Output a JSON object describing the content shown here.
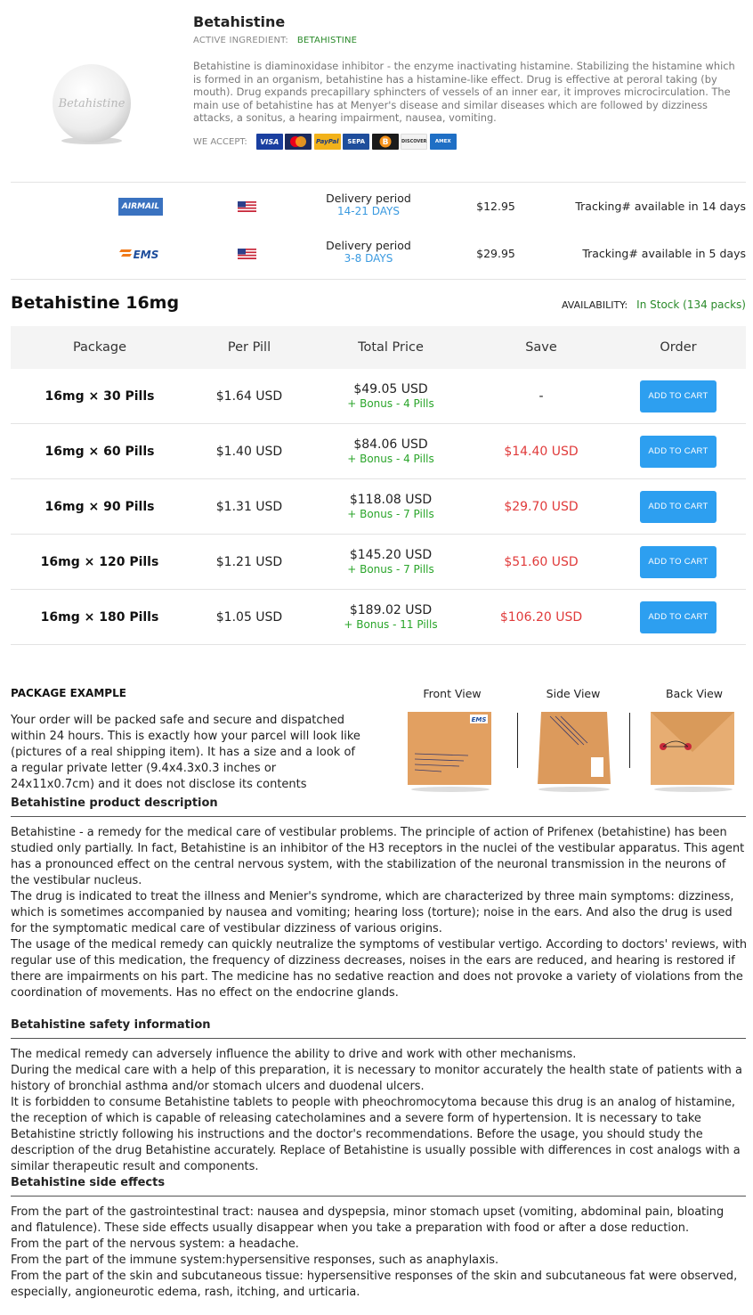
{
  "product": {
    "name": "Betahistine",
    "image_text": "Betahistine",
    "active_ingredient_label": "ACTIVE INGREDIENT:",
    "active_ingredient": "BETAHISTINE",
    "description": "Betahistine is diaminoxidase inhibitor - the enzyme inactivating histamine. Stabilizing the histamine which is formed in an organism, betahistine has a histamine-like effect. Drug is effective at peroral taking (by mouth). Drug expands precapillary sphincters of vessels of an inner ear, it improves microcirculation. The main use of betahistine has at Menyer's disease and similar diseases which are followed by dizziness attacks, a sonitus, a hearing impairment, nausea, vomiting.",
    "we_accept_label": "WE ACCEPT:",
    "payment_methods": [
      {
        "name": "VISA",
        "color": "#1a3fa0"
      },
      {
        "name": "MC",
        "color": "#1b2a5e"
      },
      {
        "name": "PayPal",
        "color": "#f2b21a"
      },
      {
        "name": "SEPA",
        "color": "#1f4e9c"
      },
      {
        "name": "B",
        "color": "#f7931a"
      },
      {
        "name": "DISCOVER",
        "color": "#f2f2f2"
      },
      {
        "name": "AMEX",
        "color": "#1f6fc5"
      }
    ]
  },
  "shipping": [
    {
      "carrier": "AIRMAIL",
      "flag": "us-flag",
      "period_label": "Delivery period",
      "days": "14-21 DAYS",
      "price": "$12.95",
      "tracking": "Tracking# available in 14 days"
    },
    {
      "carrier": "EMS",
      "flag": "us-flag",
      "period_label": "Delivery period",
      "days": "3-8 DAYS",
      "price": "$29.95",
      "tracking": "Tracking# available in 5 days"
    }
  ],
  "strength": {
    "title": "Betahistine 16mg",
    "availability_label": "AVAILABILITY:",
    "availability": "In Stock (134 packs)"
  },
  "table": {
    "headers": [
      "Package",
      "Per Pill",
      "Total Price",
      "Save",
      "Order"
    ],
    "rows": [
      {
        "package": "16mg × 30 Pills",
        "per_pill": "$1.64 USD",
        "total": "$49.05 USD",
        "bonus": "+ Bonus - 4 Pills",
        "save": "-",
        "button": "ADD TO CART"
      },
      {
        "package": "16mg × 60 Pills",
        "per_pill": "$1.40 USD",
        "total": "$84.06 USD",
        "bonus": "+ Bonus - 4 Pills",
        "save": "$14.40 USD",
        "button": "ADD TO CART"
      },
      {
        "package": "16mg × 90 Pills",
        "per_pill": "$1.31 USD",
        "total": "$118.08 USD",
        "bonus": "+ Bonus - 7 Pills",
        "save": "$29.70 USD",
        "button": "ADD TO CART"
      },
      {
        "package": "16mg × 120 Pills",
        "per_pill": "$1.21 USD",
        "total": "$145.20 USD",
        "bonus": "+ Bonus - 7 Pills",
        "save": "$51.60 USD",
        "button": "ADD TO CART"
      },
      {
        "package": "16mg × 180 Pills",
        "per_pill": "$1.05 USD",
        "total": "$189.02 USD",
        "bonus": "+ Bonus - 11 Pills",
        "save": "$106.20 USD",
        "button": "ADD TO CART"
      }
    ]
  },
  "package_example": {
    "title": "PACKAGE EXAMPLE",
    "text": "Your order will be packed safe and secure and dispatched within 24 hours. This is exactly how your parcel will look like (pictures of a real shipping item). It has a size and a look of a regular private letter (9.4x4.3x0.3 inches or 24x11x0.7cm) and it does not disclose its contents",
    "views": [
      "Front View",
      "Side View",
      "Back View"
    ]
  },
  "sections": [
    {
      "title": "Betahistine product description",
      "paragraphs": [
        "Betahistine - a remedy for the medical care of vestibular problems. The principle of action of Prifenex (betahistine) has been studied only partially. In fact, Betahistine is an inhibitor of the H3 receptors in the nuclei of the vestibular apparatus. This agent has a pronounced effect on the central nervous system, with the stabilization of the neuronal transmission in the neurons of the vestibular nucleus.",
        "The drug is indicated to treat the illness and Menier's syndrome, which are characterized by three main symptoms: dizziness, which is sometimes accompanied by nausea and vomiting; hearing loss (torture); noise in the ears. And also the drug is used for the symptomatic medical care of vestibular dizziness of various origins.",
        "The usage of the medical remedy can quickly neutralize the symptoms of vestibular vertigo. According to doctors' reviews, with regular use of this medication, the frequency of dizziness decreases, noises in the ears are reduced, and hearing is restored if there are impairments on his part. The medicine has no sedative reaction and does not provoke a variety of violations from the coordination of movements. Has no effect on the endocrine glands."
      ]
    },
    {
      "title": "Betahistine safety information",
      "paragraphs": [
        "The medical remedy can adversely influence the ability to drive and work with other mechanisms.",
        "During the medical care with a help of this preparation, it is necessary to monitor accurately the health state of patients with a history of bronchial asthma and/or stomach ulcers and duodenal ulcers.",
        "It is forbidden to consume Betahistine tablets to people with pheochromocytoma because this drug is an analog of histamine, the reception of which is capable of releasing catecholamines and a severe form of hypertension. It is necessary to take Betahistine strictly following his instructions and the doctor's recommendations. Before the usage, you should study the description of the drug Betahistine accurately. Replace of Betahistine is usually possible with differences in cost analogs with a similar therapeutic result and components."
      ]
    },
    {
      "title": "Betahistine side effects",
      "paragraphs": [
        "From the part of the gastrointestinal tract: nausea and dyspepsia, minor stomach upset (vomiting, abdominal pain, bloating and flatulence). These side effects usually disappear when you take a preparation with food or after a dose reduction.",
        "From the part of the nervous system: a headache.",
        "From the part of the immune system:hypersensitive responses, such as anaphylaxis.",
        "From the part of the skin and subcutaneous tissue: hypersensitive responses of the skin and subcutaneous fat were observed, especially, angioneurotic edema, rash, itching, and urticaria."
      ]
    }
  ]
}
